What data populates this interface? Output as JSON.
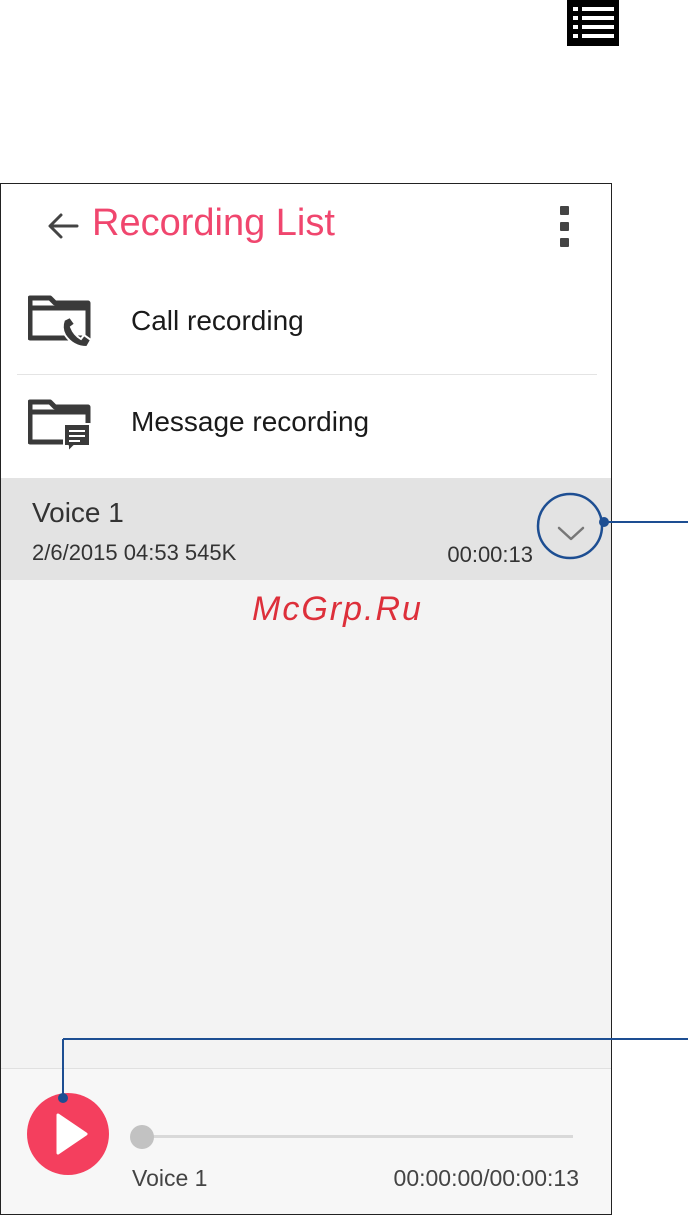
{
  "header": {
    "title": "Recording List"
  },
  "folders": [
    {
      "label": "Call recording",
      "icon": "call-folder-icon"
    },
    {
      "label": "Message recording",
      "icon": "message-folder-icon"
    }
  ],
  "recordings": [
    {
      "name": "Voice 1",
      "meta": "2/6/2015 04:53   545K",
      "duration": "00:00:13"
    }
  ],
  "player": {
    "track_name": "Voice 1",
    "time": "00:00:00/00:00:13",
    "progress": 0
  },
  "watermark": "McGrp.Ru",
  "colors": {
    "accent": "#f0466e",
    "play_button": "#f43f5e",
    "callout": "#1d4e92"
  }
}
